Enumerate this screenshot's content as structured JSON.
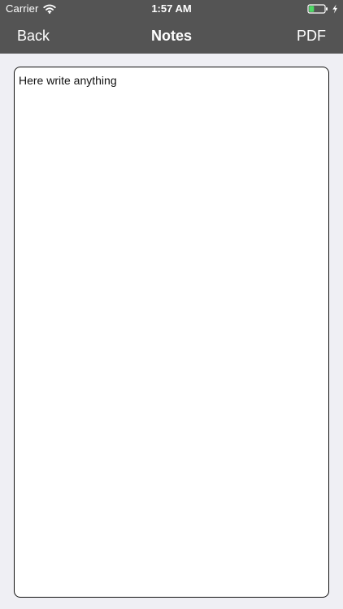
{
  "status_bar": {
    "carrier": "Carrier",
    "time": "1:57 AM",
    "icons": {
      "wifi": "wifi-icon",
      "battery": "battery-icon",
      "charging": "charging-bolt-icon"
    }
  },
  "nav_bar": {
    "back_label": "Back",
    "title": "Notes",
    "pdf_label": "PDF"
  },
  "notes_editor": {
    "value": "Here write anything"
  },
  "colors": {
    "nav_background": "#545454",
    "nav_text": "#ffffff",
    "page_background": "#efeff4",
    "editor_background": "#ffffff",
    "editor_border": "#111111",
    "battery_fill": "#4cd964"
  }
}
